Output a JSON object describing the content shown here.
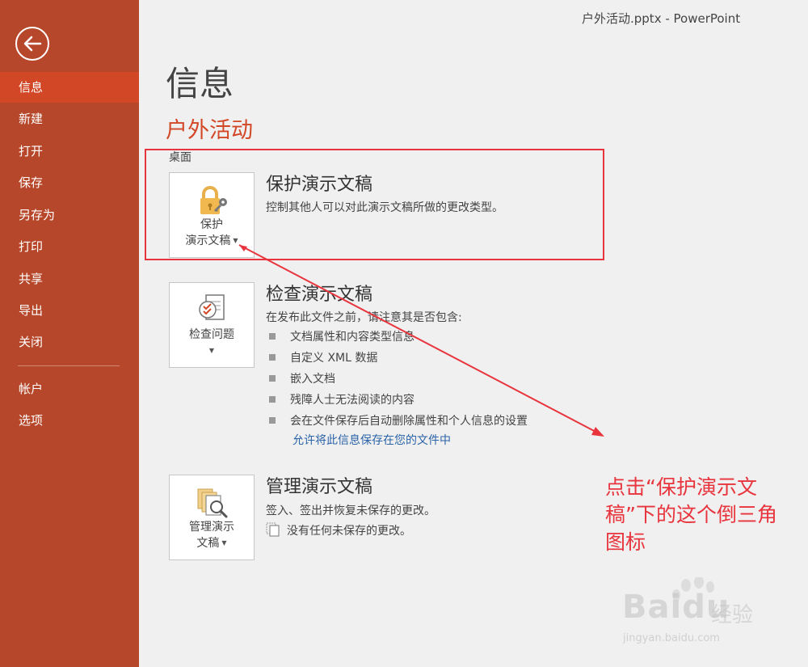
{
  "window": {
    "title": "户外活动.pptx - PowerPoint"
  },
  "sidebar": {
    "back_icon": "back-arrow-icon",
    "items": [
      {
        "label": "信息",
        "active": true
      },
      {
        "label": "新建"
      },
      {
        "label": "打开"
      },
      {
        "label": "保存"
      },
      {
        "label": "另存为"
      },
      {
        "label": "打印"
      },
      {
        "label": "共享"
      },
      {
        "label": "导出"
      },
      {
        "label": "关闭"
      },
      {
        "label": "帐户"
      },
      {
        "label": "选项"
      }
    ],
    "color": "#b7472a",
    "active_color": "#d24726"
  },
  "main": {
    "title": "信息",
    "file_name": "户外活动",
    "file_location": "桌面",
    "protect": {
      "button_line1": "保护",
      "button_line2": "演示文稿",
      "icon": "lock-key-icon",
      "title": "保护演示文稿",
      "description": "控制其他人可以对此演示文稿所做的更改类型。"
    },
    "inspect": {
      "button_label": "检查问题",
      "icon": "document-check-icon",
      "title": "检查演示文稿",
      "description": "在发布此文件之前，请注意其是否包含:",
      "bullets": [
        "文档属性和内容类型信息",
        "自定义 XML 数据",
        "嵌入文档",
        "残障人士无法阅读的内容",
        "会在文件保存后自动删除属性和个人信息的设置"
      ],
      "link": "允许将此信息保存在您的文件中"
    },
    "manage": {
      "button_line1": "管理演示",
      "button_line2": "文稿",
      "icon": "documents-magnifier-icon",
      "title": "管理演示文稿",
      "description": "签入、签出并恢复未保存的更改。",
      "no_unsaved": "没有任何未保存的更改。"
    }
  },
  "annotation": {
    "callout": "点击“保护演示文稿”下的这个倒三角图标",
    "color": "#e8343d"
  },
  "watermark": {
    "brand": "Bai",
    "brand2": "du",
    "cn": "经验",
    "url": "jingyan.baidu.com"
  }
}
